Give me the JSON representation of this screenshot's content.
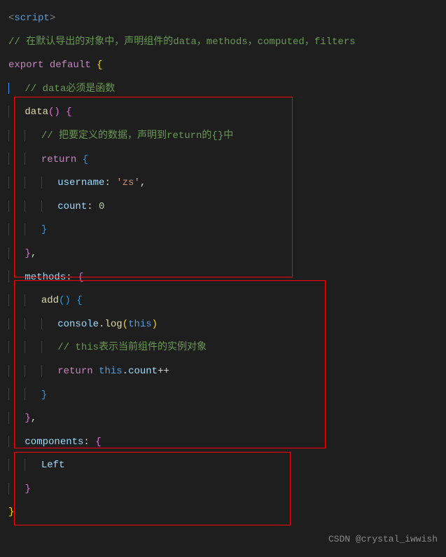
{
  "code": {
    "scriptTag": "<script>",
    "comment1": "// 在默认导出的对象中，声明组件的data，methods，computed，filters",
    "exportKw": "export",
    "defaultKw": "default",
    "comment2": "// data必须是函数",
    "dataFn": "data",
    "comment3": "// 把要定义的数据，声明到return的{}中",
    "returnKw": "return",
    "usernameKey": "username",
    "usernameVal": "'zs'",
    "countKey": "count",
    "countVal": "0",
    "methodsKey": "methods",
    "addFn": "add",
    "consoleObj": "console",
    "logFn": "log",
    "thisKw": "this",
    "comment4": "// this表示当前组件的实例对象",
    "countProp": "count",
    "incOp": "++",
    "componentsKey": "components",
    "leftComp": "Left",
    "watermark": "CSDN @crystal_iwwish"
  }
}
